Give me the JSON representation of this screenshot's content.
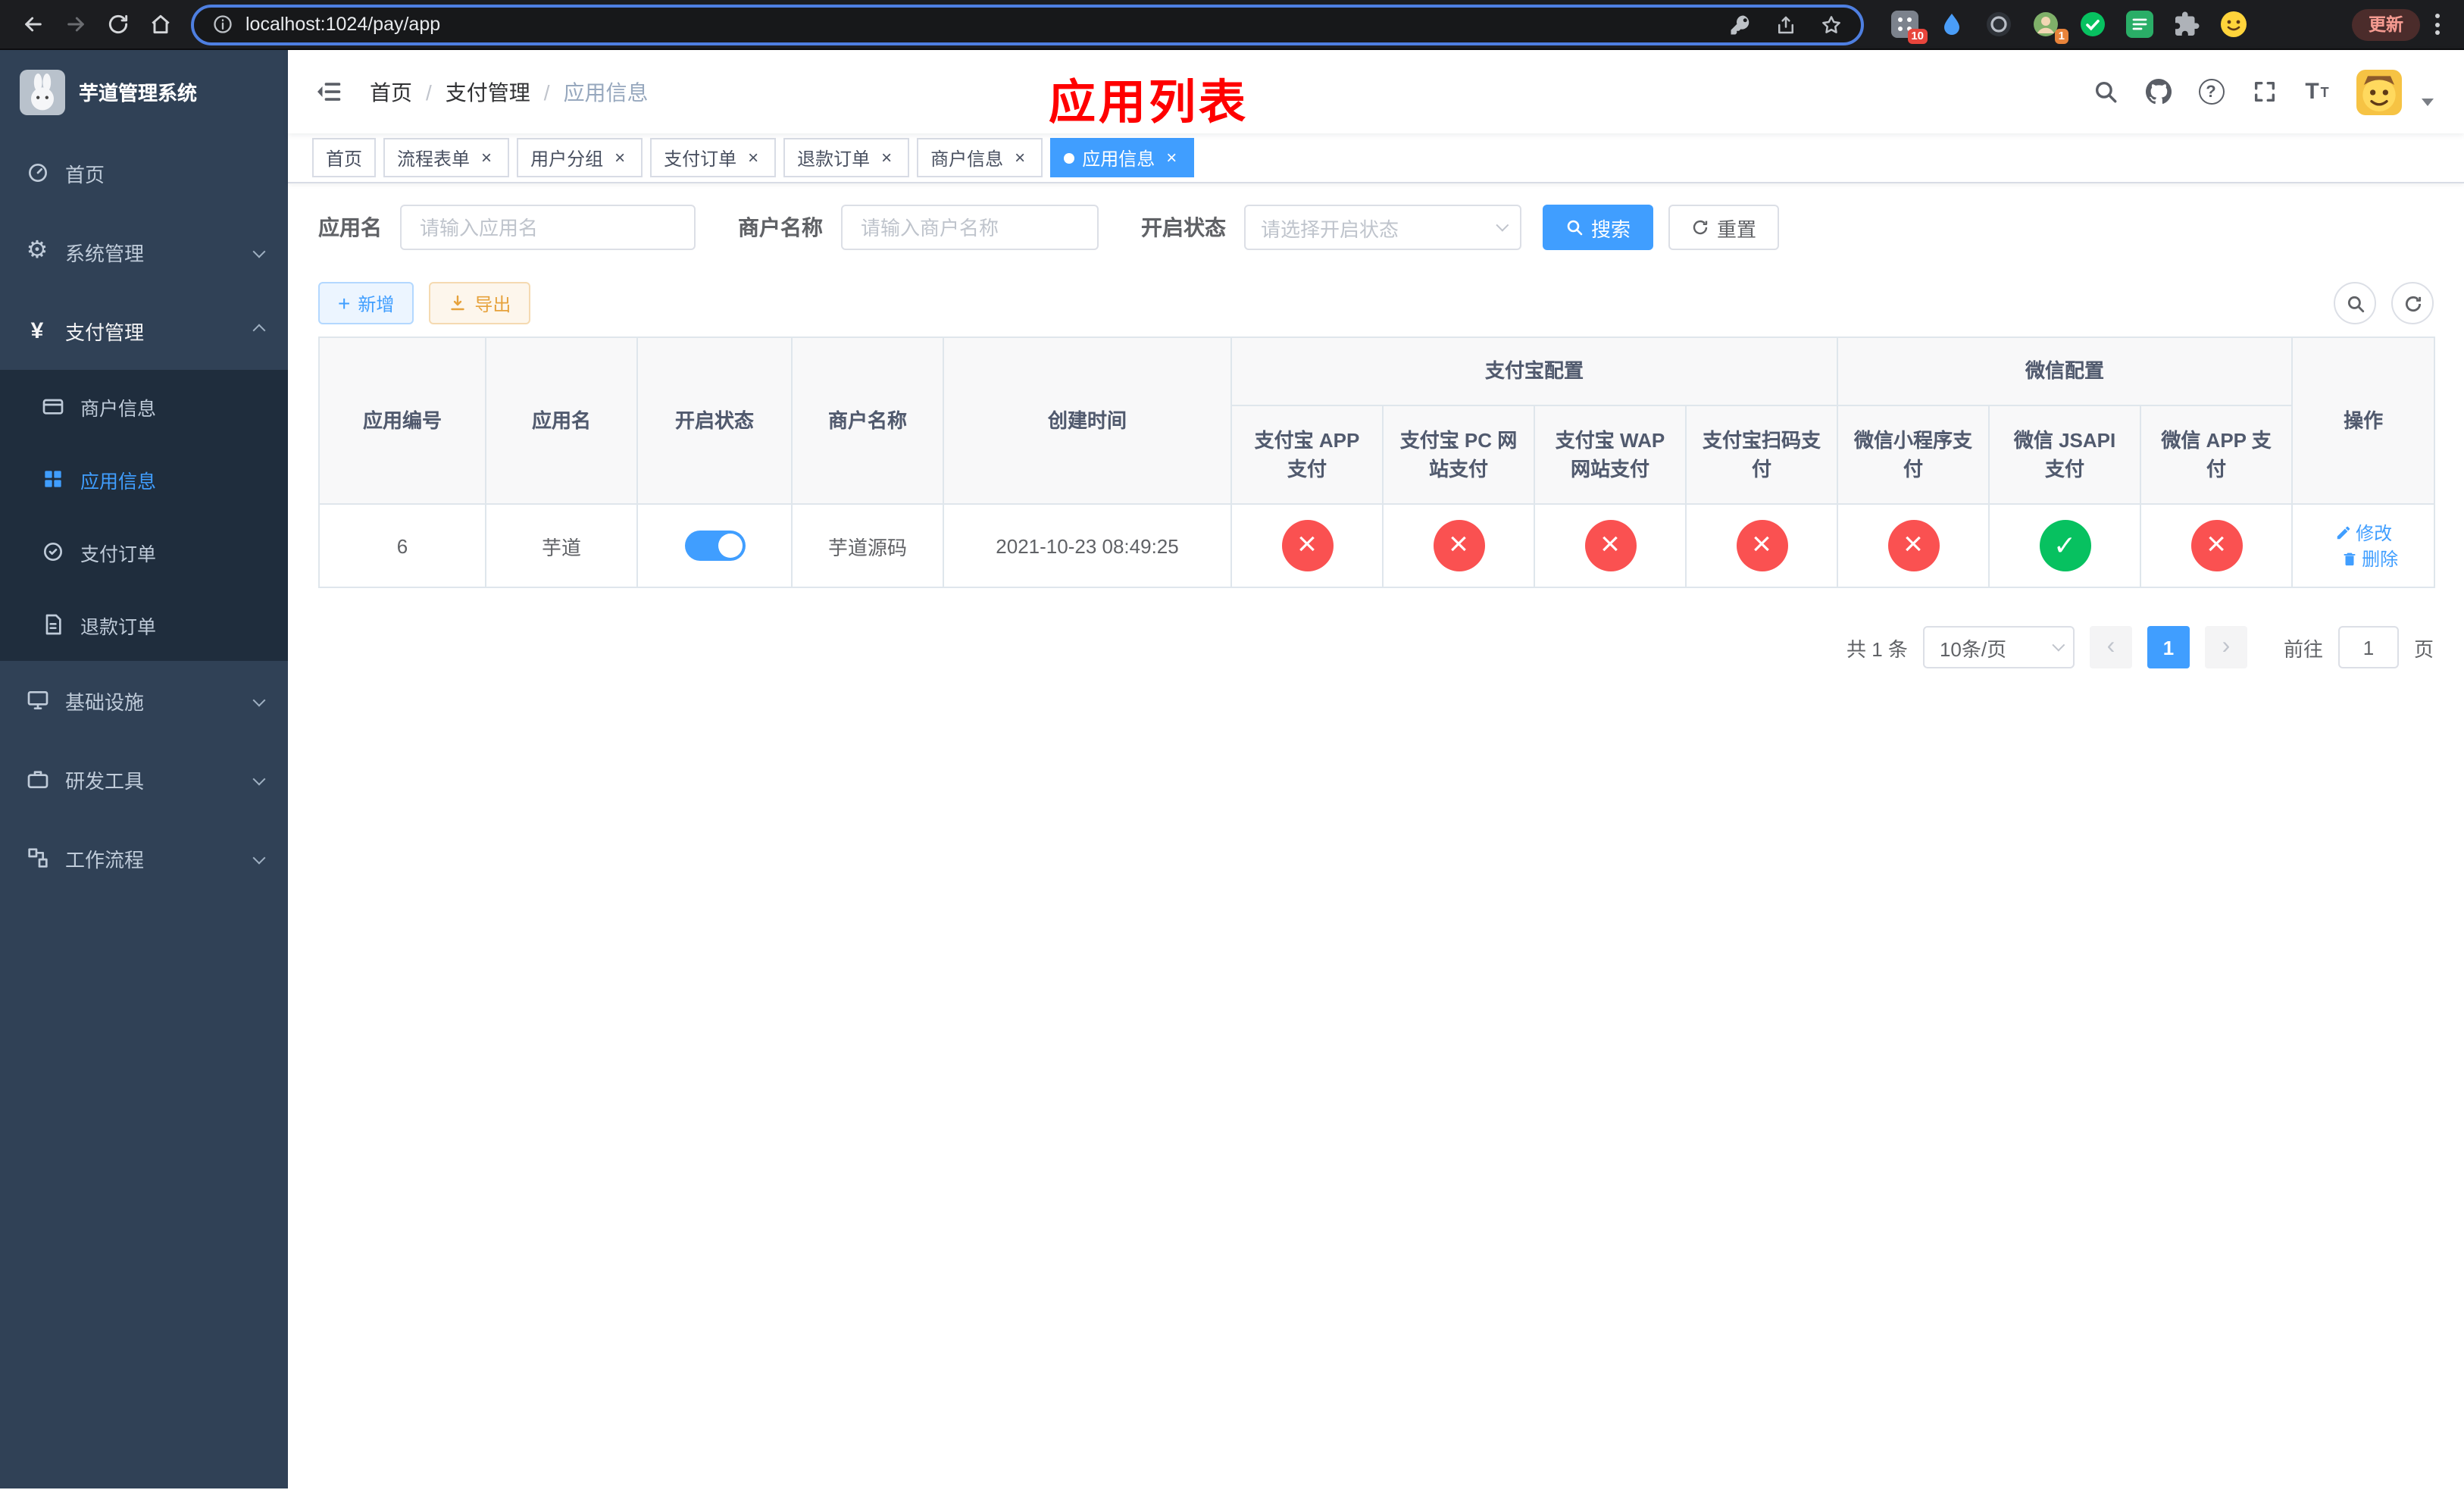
{
  "browser": {
    "url": "localhost:1024/pay/app",
    "update_label": "更新",
    "badge_grid": "10",
    "badge_avatar": "1"
  },
  "sidebar": {
    "title": "芋道管理系统",
    "menu": [
      {
        "label": "首页"
      },
      {
        "label": "系统管理"
      },
      {
        "label": "支付管理"
      },
      {
        "label": "基础设施"
      },
      {
        "label": "研发工具"
      },
      {
        "label": "工作流程"
      }
    ],
    "submenu": [
      {
        "label": "商户信息"
      },
      {
        "label": "应用信息"
      },
      {
        "label": "支付订单"
      },
      {
        "label": "退款订单"
      }
    ]
  },
  "navbar": {
    "breadcrumb": [
      "首页",
      "支付管理",
      "应用信息"
    ],
    "annotation": "应用列表"
  },
  "tabs": [
    {
      "label": "首页",
      "closable": false,
      "active": false
    },
    {
      "label": "流程表单",
      "closable": true,
      "active": false
    },
    {
      "label": "用户分组",
      "closable": true,
      "active": false
    },
    {
      "label": "支付订单",
      "closable": true,
      "active": false
    },
    {
      "label": "退款订单",
      "closable": true,
      "active": false
    },
    {
      "label": "商户信息",
      "closable": true,
      "active": false
    },
    {
      "label": "应用信息",
      "closable": true,
      "active": true
    }
  ],
  "filter": {
    "app_name_label": "应用名",
    "app_name_placeholder": "请输入应用名",
    "merchant_label": "商户名称",
    "merchant_placeholder": "请输入商户名称",
    "status_label": "开启状态",
    "status_placeholder": "请选择开启状态",
    "search_label": "搜索",
    "reset_label": "重置"
  },
  "toolbar": {
    "add_label": "新增",
    "export_label": "导出"
  },
  "table": {
    "headers": {
      "app_id": "应用编号",
      "app_name": "应用名",
      "status": "开启状态",
      "merchant": "商户名称",
      "created": "创建时间",
      "alipay_group": "支付宝配置",
      "wechat_group": "微信配置",
      "alipay_app": "支付宝 APP 支付",
      "alipay_pc": "支付宝 PC 网站支付",
      "alipay_wap": "支付宝 WAP 网站支付",
      "alipay_qr": "支付宝扫码支付",
      "wechat_lite": "微信小程序支付",
      "wechat_jsapi": "微信 JSAPI 支付",
      "wechat_app": "微信 APP 支付",
      "actions": "操作"
    },
    "row": {
      "app_id": "6",
      "app_name": "芋道",
      "status_on": true,
      "merchant": "芋道源码",
      "created_at": "2021-10-23 08:49:25",
      "alipay_app": false,
      "alipay_pc": false,
      "alipay_wap": false,
      "alipay_qr": false,
      "wechat_lite": false,
      "wechat_jsapi": true,
      "wechat_app": false,
      "edit_label": "修改",
      "delete_label": "删除"
    }
  },
  "pagination": {
    "total": "共 1 条",
    "page_size": "10条/页",
    "current_page": "1",
    "goto_label": "前往",
    "page_unit": "页",
    "jump_value": "1"
  },
  "icons": {
    "close": "×",
    "check": "✓",
    "cross": "×",
    "prev": "‹",
    "next": "›",
    "plus": "+",
    "yen": "¥",
    "gear": "⚙",
    "help": "?",
    "font_size": "T"
  },
  "colors": {
    "primary": "#409eff",
    "success": "#07c160",
    "danger": "#fa5151",
    "warning": "#e6a23c",
    "sidebar_bg": "#304156",
    "submenu_bg": "#1f2d3d",
    "annotation_red": "#ff0000"
  }
}
